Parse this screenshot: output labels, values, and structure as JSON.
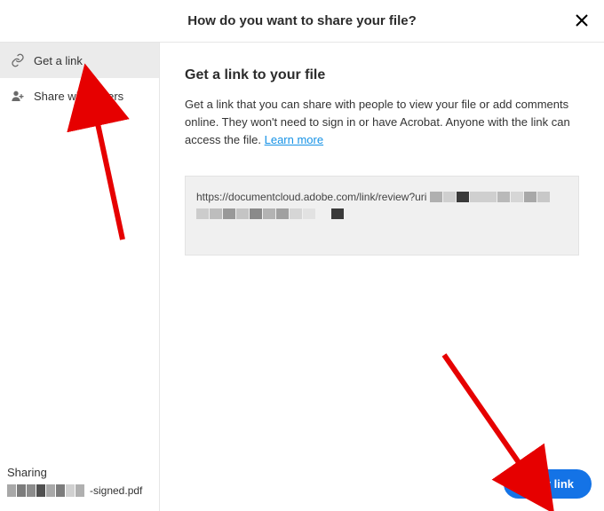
{
  "header": {
    "title": "How do you want to share your file?"
  },
  "sidebar": {
    "items": [
      {
        "label": "Get a link"
      },
      {
        "label": "Share with others"
      }
    ],
    "footer": {
      "label": "Sharing",
      "filename_suffix": "-signed.pdf"
    }
  },
  "main": {
    "heading": "Get a link to your file",
    "description": "Get a link that you can share with people to view your file or add comments online. They won't need to sign in or have Acrobat. Anyone with the link can access the file. ",
    "learn_more": "Learn more",
    "link_visible": "https://documentcloud.adobe.com/link/review?uri",
    "copy_button": "Copy link"
  }
}
